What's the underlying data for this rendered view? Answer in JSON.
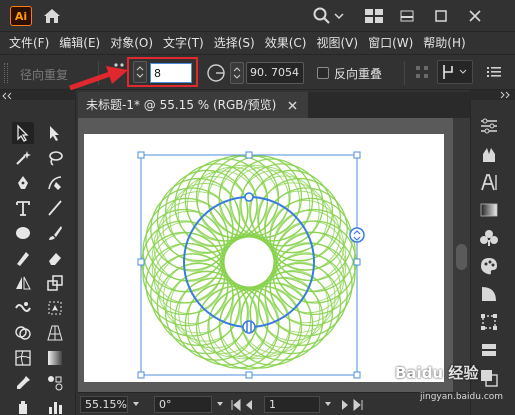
{
  "app": {
    "logo_text": "Ai"
  },
  "menu": [
    "文件(F)",
    "编辑(E)",
    "对象(O)",
    "文字(T)",
    "选择(S)",
    "效果(C)",
    "视图(V)",
    "窗口(W)",
    "帮助(H)"
  ],
  "control_bar": {
    "label": "径向重复",
    "instances_value": "8",
    "angle_value": "90. 7054",
    "reverse_overlap_label": "反向重叠"
  },
  "document": {
    "tab_title": "未标题-1* @ 55.15 % (RGB/预览)"
  },
  "status_bar": {
    "zoom": "55.15%",
    "rotation": "0°",
    "artboard_number": "1"
  },
  "watermark": {
    "text": "Baidu 经验",
    "sub": "jingyan.baidu.com"
  },
  "colors": {
    "accent": "#4b8ddb",
    "pattern": "#86d24a",
    "highlight": "#e0282e"
  }
}
